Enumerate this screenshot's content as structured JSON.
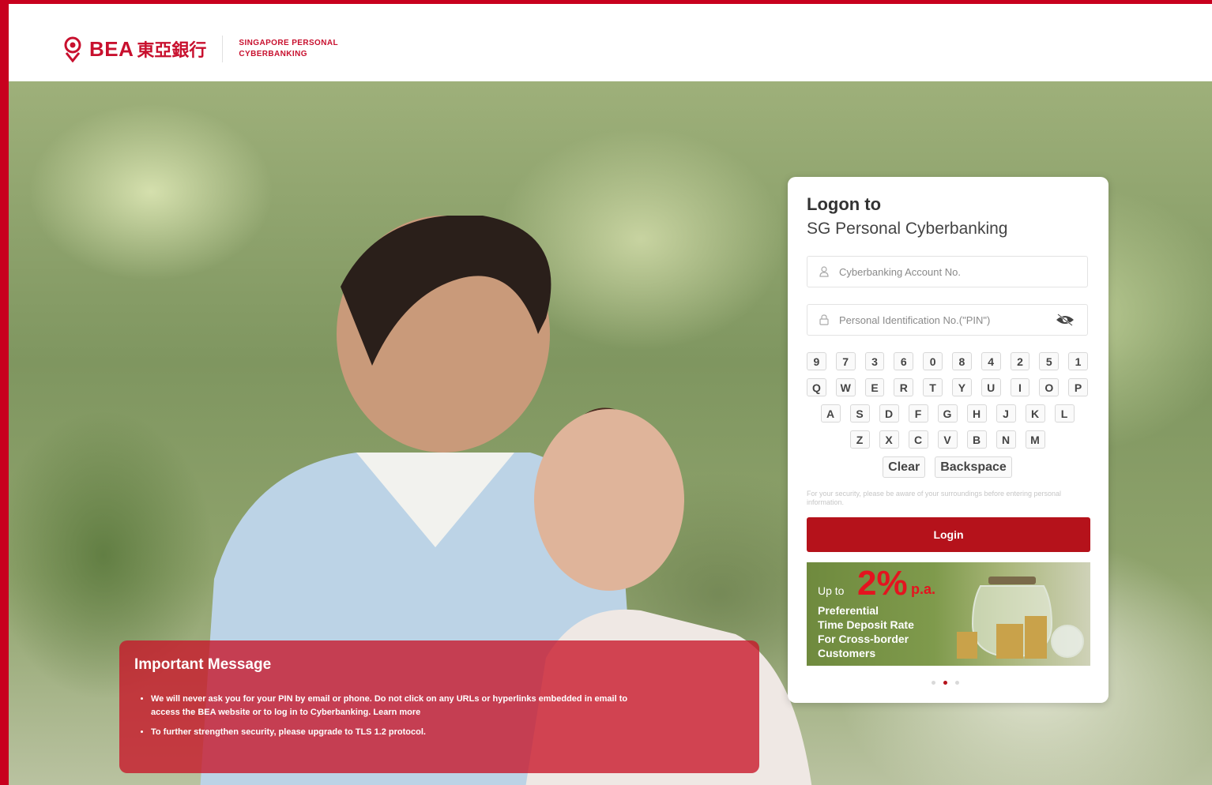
{
  "brand": {
    "name": "BEA",
    "name_cn": "東亞銀行",
    "subtitle_line1": "SINGAPORE PERSONAL",
    "subtitle_line2": "CYBERBANKING",
    "color": "#c8102e"
  },
  "login": {
    "title": "Logon to",
    "subtitle": "SG Personal Cyberbanking",
    "account_field": {
      "placeholder": "Cyberbanking Account No.",
      "value": "",
      "icon": "user-icon"
    },
    "pin_field": {
      "placeholder": "Personal Identification No.(\"PIN\")",
      "value": "",
      "icon": "lock-icon",
      "toggle_icon": "eye-slash-icon"
    },
    "keypad": {
      "digits": [
        "9",
        "7",
        "3",
        "6",
        "0",
        "8",
        "4",
        "2",
        "5",
        "1"
      ],
      "row1": [
        "Q",
        "W",
        "E",
        "R",
        "T",
        "Y",
        "U",
        "I",
        "O",
        "P"
      ],
      "row2": [
        "A",
        "S",
        "D",
        "F",
        "G",
        "H",
        "J",
        "K",
        "L"
      ],
      "row3": [
        "Z",
        "X",
        "C",
        "V",
        "B",
        "N",
        "M"
      ],
      "clear_label": "Clear",
      "backspace_label": "Backspace"
    },
    "security_note": "For your security, please be aware of your surroundings before entering personal information.",
    "login_label": "Login",
    "login_color": "#b5121b"
  },
  "promo": {
    "up_to": "Up to",
    "rate": "2%",
    "pa": "p.a.",
    "line1": "Preferential",
    "line2": "Time Deposit Rate",
    "line3": "For Cross-border",
    "line4": "Customers",
    "carousel_count": 3,
    "carousel_active": 2
  },
  "important": {
    "title": "Important Message",
    "item1": "We will never ask you for your PIN by email or phone. Do not click on any URLs or hyperlinks embedded in email to access the BEA website or to log in to Cyberbanking.",
    "learn_more": "Learn more",
    "item2": "To further strengthen security, please upgrade to TLS 1.2 protocol."
  }
}
